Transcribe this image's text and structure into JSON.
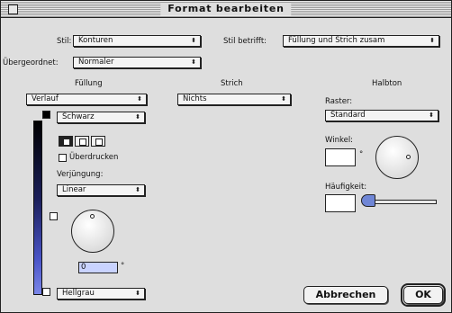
{
  "window": {
    "title": "Format bearbeiten"
  },
  "top": {
    "stil_label": "Stil:",
    "stil_value": "Konturen",
    "stil_betrifft_label": "Stil betrifft:",
    "stil_betrifft_value": "Füllung und Strich zusam",
    "uebergeordnet_label": "Übergeordnet:",
    "uebergeordnet_value": "Normaler"
  },
  "fuellung": {
    "header": "Füllung",
    "type_value": "Verlauf",
    "color_value": "Schwarz",
    "ueberdrucken_label": "Überdrucken",
    "verjuengung_label": "Verjüngung:",
    "verjuengung_value": "Linear",
    "angle_value": "0",
    "angle_unit": "°",
    "end_color_value": "Hellgrau"
  },
  "strich": {
    "header": "Strich",
    "value": "Nichts"
  },
  "halbton": {
    "header": "Halbton",
    "raster_label": "Raster:",
    "raster_value": "Standard",
    "winkel_label": "Winkel:",
    "winkel_value": "",
    "winkel_unit": "°",
    "haeufigkeit_label": "Häufigkeit:",
    "haeufigkeit_value": ""
  },
  "buttons": {
    "cancel": "Abbrechen",
    "ok": "OK"
  }
}
